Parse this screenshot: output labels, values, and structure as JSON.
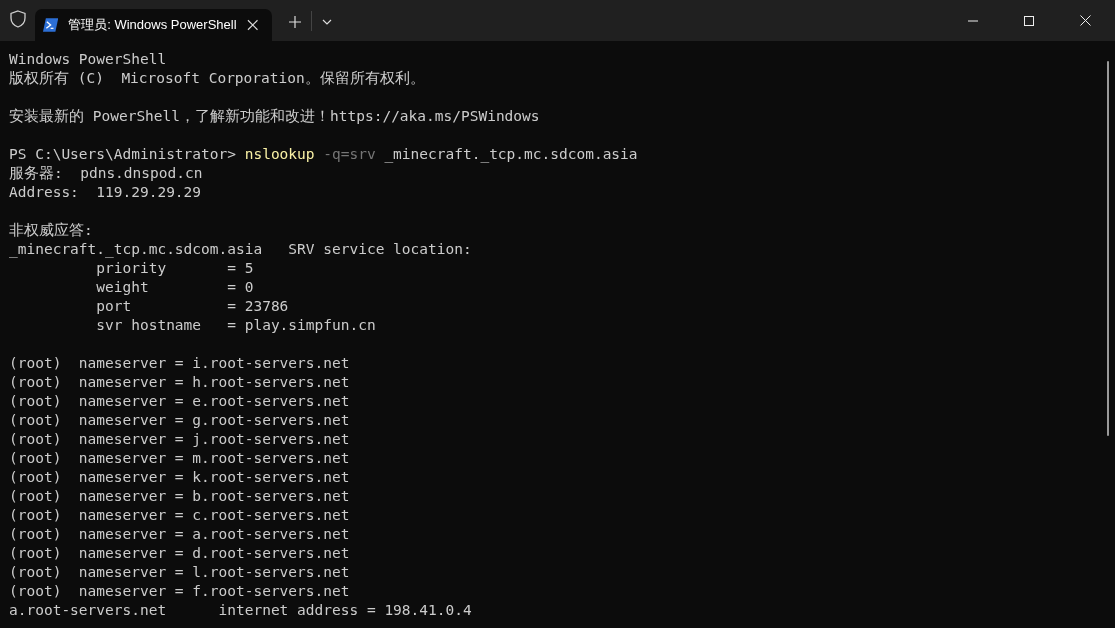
{
  "tab": {
    "title": "管理员: Windows PowerShell",
    "selected": true
  },
  "lines": [
    {
      "kind": "text",
      "segments": [
        {
          "kind": "plain",
          "text": "Windows PowerShell"
        }
      ]
    },
    {
      "kind": "text",
      "segments": [
        {
          "kind": "plain",
          "text": "版权所有 (C)  Microsoft Corporation。保留所有权利。"
        }
      ]
    },
    {
      "kind": "blank"
    },
    {
      "kind": "text",
      "segments": [
        {
          "kind": "plain",
          "text": "安装最新的 PowerShell，了解新功能和改进！https://aka.ms/PSWindows"
        }
      ]
    },
    {
      "kind": "blank"
    },
    {
      "kind": "text",
      "segments": [
        {
          "kind": "plain",
          "text": "PS C:\\Users\\Administrator> "
        },
        {
          "kind": "command",
          "text": "nslookup"
        },
        {
          "kind": "parameter",
          "text": " -q=srv"
        },
        {
          "kind": "plain",
          "text": " _minecraft._tcp.mc.sdcom.asia"
        }
      ]
    },
    {
      "kind": "text",
      "segments": [
        {
          "kind": "plain",
          "text": "服务器:  pdns.dnspod.cn"
        }
      ]
    },
    {
      "kind": "text",
      "segments": [
        {
          "kind": "plain",
          "text": "Address:  119.29.29.29"
        }
      ]
    },
    {
      "kind": "blank"
    },
    {
      "kind": "text",
      "segments": [
        {
          "kind": "plain",
          "text": "非权威应答:"
        }
      ]
    },
    {
      "kind": "text",
      "segments": [
        {
          "kind": "plain",
          "text": "_minecraft._tcp.mc.sdcom.asia   SRV service location:"
        }
      ]
    },
    {
      "kind": "text",
      "segments": [
        {
          "kind": "plain",
          "text": "          priority       = 5"
        }
      ]
    },
    {
      "kind": "text",
      "segments": [
        {
          "kind": "plain",
          "text": "          weight         = 0"
        }
      ]
    },
    {
      "kind": "text",
      "segments": [
        {
          "kind": "plain",
          "text": "          port           = 23786"
        }
      ]
    },
    {
      "kind": "text",
      "segments": [
        {
          "kind": "plain",
          "text": "          svr hostname   = play.simpfun.cn"
        }
      ]
    },
    {
      "kind": "blank"
    },
    {
      "kind": "text",
      "segments": [
        {
          "kind": "plain",
          "text": "(root)  nameserver = i.root-servers.net"
        }
      ]
    },
    {
      "kind": "text",
      "segments": [
        {
          "kind": "plain",
          "text": "(root)  nameserver = h.root-servers.net"
        }
      ]
    },
    {
      "kind": "text",
      "segments": [
        {
          "kind": "plain",
          "text": "(root)  nameserver = e.root-servers.net"
        }
      ]
    },
    {
      "kind": "text",
      "segments": [
        {
          "kind": "plain",
          "text": "(root)  nameserver = g.root-servers.net"
        }
      ]
    },
    {
      "kind": "text",
      "segments": [
        {
          "kind": "plain",
          "text": "(root)  nameserver = j.root-servers.net"
        }
      ]
    },
    {
      "kind": "text",
      "segments": [
        {
          "kind": "plain",
          "text": "(root)  nameserver = m.root-servers.net"
        }
      ]
    },
    {
      "kind": "text",
      "segments": [
        {
          "kind": "plain",
          "text": "(root)  nameserver = k.root-servers.net"
        }
      ]
    },
    {
      "kind": "text",
      "segments": [
        {
          "kind": "plain",
          "text": "(root)  nameserver = b.root-servers.net"
        }
      ]
    },
    {
      "kind": "text",
      "segments": [
        {
          "kind": "plain",
          "text": "(root)  nameserver = c.root-servers.net"
        }
      ]
    },
    {
      "kind": "text",
      "segments": [
        {
          "kind": "plain",
          "text": "(root)  nameserver = a.root-servers.net"
        }
      ]
    },
    {
      "kind": "text",
      "segments": [
        {
          "kind": "plain",
          "text": "(root)  nameserver = d.root-servers.net"
        }
      ]
    },
    {
      "kind": "text",
      "segments": [
        {
          "kind": "plain",
          "text": "(root)  nameserver = l.root-servers.net"
        }
      ]
    },
    {
      "kind": "text",
      "segments": [
        {
          "kind": "plain",
          "text": "(root)  nameserver = f.root-servers.net"
        }
      ]
    },
    {
      "kind": "text",
      "segments": [
        {
          "kind": "plain",
          "text": "a.root-servers.net      internet address = 198.41.0.4"
        }
      ]
    }
  ]
}
